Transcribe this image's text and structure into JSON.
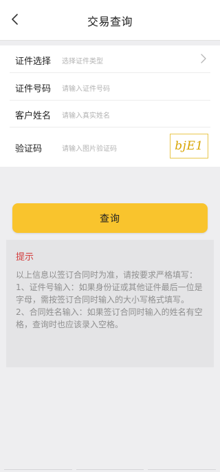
{
  "header": {
    "title": "交易查询",
    "back_icon": "chevron-left-icon"
  },
  "form": {
    "id_type": {
      "label": "证件选择",
      "placeholder": "选择证件类型",
      "icon": "chevron-right-icon"
    },
    "id_number": {
      "label": "证件号码",
      "placeholder": "请输入证件号码"
    },
    "customer_name": {
      "label": "客户姓名",
      "placeholder": "请输入真实姓名"
    },
    "captcha": {
      "label": "验证码",
      "placeholder": "请输入图片验证码",
      "image_text": "bjE1"
    }
  },
  "query_button": {
    "label": "查询",
    "color": "#f9c42d"
  },
  "tips": {
    "title": "提示",
    "title_color": "#d23a3a",
    "lines": [
      "以上信息以签订合同时为准，请按要求严格填写：",
      "1、证件号输入：如果身份证或其他证件最后一位是字母，需按签订合同时输入的大小写格式填写。",
      "2、合同姓名输入：如果签订合同时输入的姓名有空格，查询时也应该录入空格。"
    ]
  }
}
